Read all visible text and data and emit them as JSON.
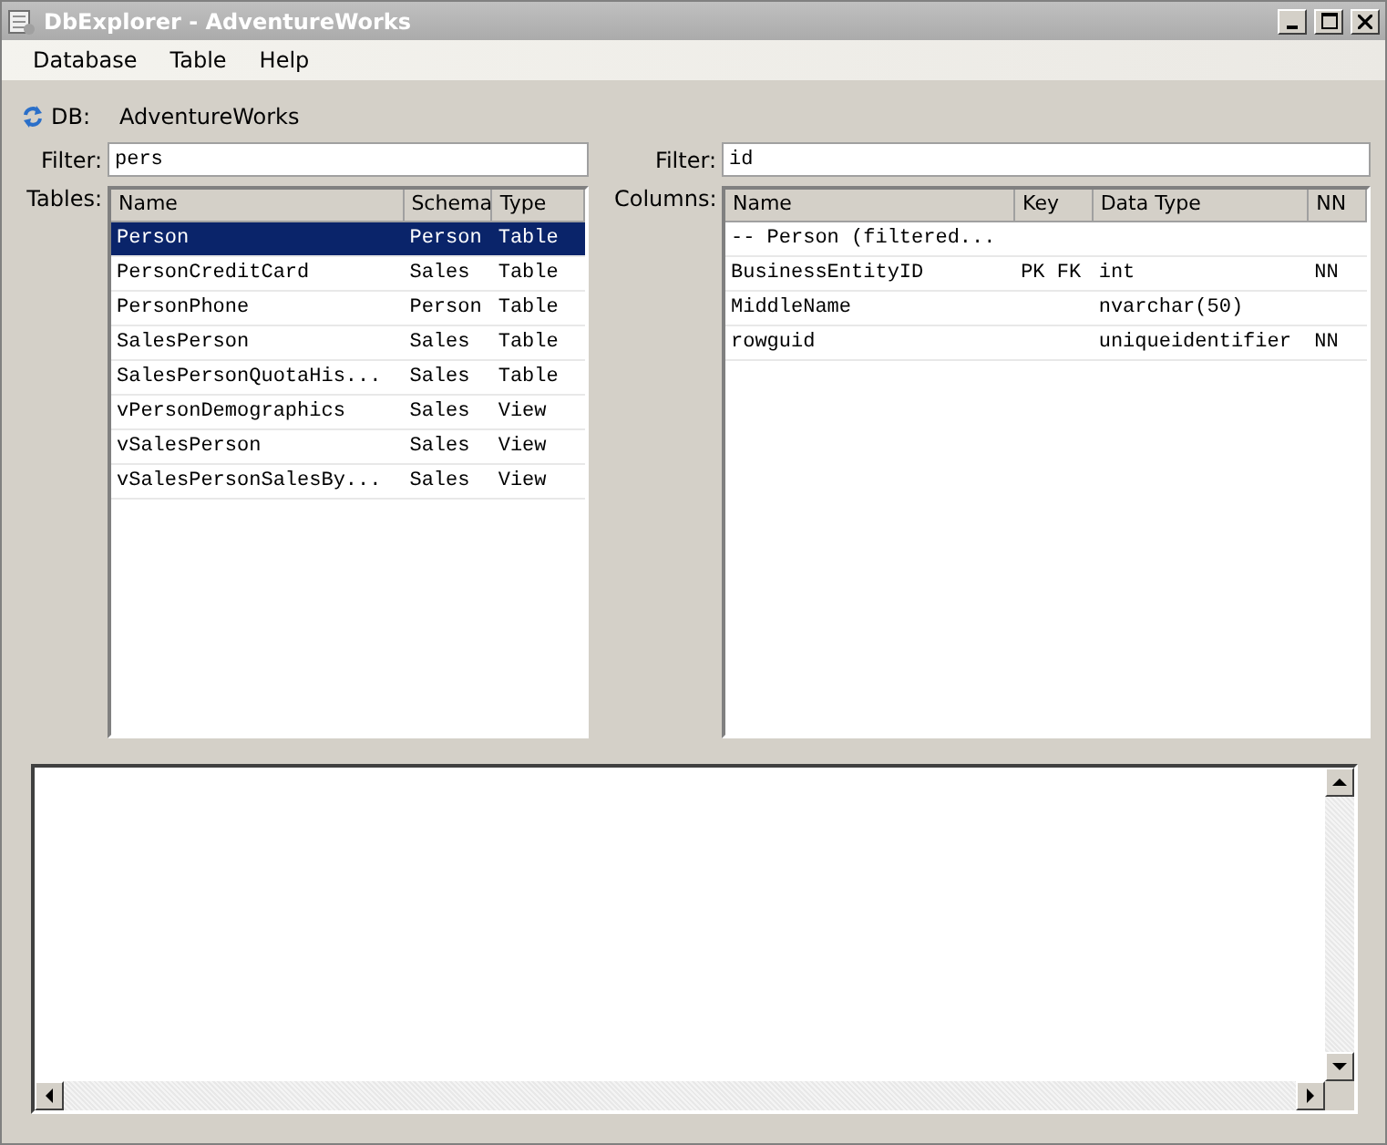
{
  "window": {
    "title": "DbExplorer - AdventureWorks"
  },
  "menu": [
    "Database",
    "Table",
    "Help"
  ],
  "db": {
    "label": "DB:",
    "name": "AdventureWorks"
  },
  "tables_filter": {
    "label": "Filter:",
    "value": "pers"
  },
  "columns_filter": {
    "label": "Filter:",
    "value": "id"
  },
  "tables": {
    "label": "Tables:",
    "columns": [
      "Name",
      "Schema",
      "Type"
    ],
    "rows": [
      {
        "cells": [
          "Person",
          "Person",
          "Table"
        ],
        "selected": true
      },
      {
        "cells": [
          "PersonCreditCard",
          "Sales",
          "Table"
        ],
        "selected": false
      },
      {
        "cells": [
          "PersonPhone",
          "Person",
          "Table"
        ],
        "selected": false
      },
      {
        "cells": [
          "SalesPerson",
          "Sales",
          "Table"
        ],
        "selected": false
      },
      {
        "cells": [
          "SalesPersonQuotaHis...",
          "Sales",
          "Table"
        ],
        "selected": false
      },
      {
        "cells": [
          "vPersonDemographics",
          "Sales",
          "View"
        ],
        "selected": false
      },
      {
        "cells": [
          "vSalesPerson",
          "Sales",
          "View"
        ],
        "selected": false
      },
      {
        "cells": [
          "vSalesPersonSalesBy...",
          "Sales",
          "View"
        ],
        "selected": false
      }
    ]
  },
  "columns": {
    "label": "Columns:",
    "columns": [
      "Name",
      "Key",
      "Data Type",
      "NN"
    ],
    "rows": [
      {
        "kind": "header",
        "cells": [
          "-- Person (filtered..."
        ]
      },
      {
        "kind": "column",
        "cells": [
          "BusinessEntityID",
          "PK FK",
          "int",
          "NN"
        ]
      },
      {
        "kind": "column",
        "cells": [
          "MiddleName",
          "",
          "nvarchar(50)",
          ""
        ]
      },
      {
        "kind": "column",
        "cells": [
          "rowguid",
          "",
          "uniqueidentifier",
          "NN"
        ]
      }
    ]
  }
}
